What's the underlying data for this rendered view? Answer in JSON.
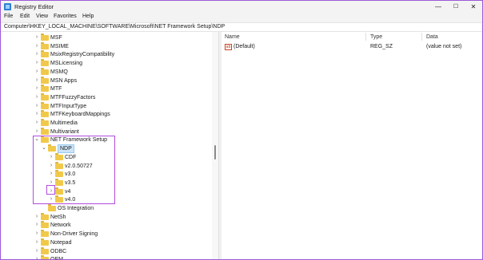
{
  "window": {
    "title": "Registry Editor",
    "minimize_glyph": "—",
    "maximize_glyph": "☐",
    "close_glyph": "✕"
  },
  "menu": [
    "File",
    "Edit",
    "View",
    "Favorites",
    "Help"
  ],
  "address": "Computer\\HKEY_LOCAL_MACHINE\\SOFTWARE\\Microsoft\\NET Framework Setup\\NDP",
  "tree": {
    "items": [
      {
        "label": "MSF",
        "expanded": false,
        "has_children": true
      },
      {
        "label": "MSIME",
        "expanded": false,
        "has_children": true
      },
      {
        "label": "MsixRegistryCompatibility",
        "expanded": false,
        "has_children": true
      },
      {
        "label": "MSLicensing",
        "expanded": false,
        "has_children": true
      },
      {
        "label": "MSMQ",
        "expanded": false,
        "has_children": true
      },
      {
        "label": "MSN Apps",
        "expanded": false,
        "has_children": true
      },
      {
        "label": "MTF",
        "expanded": false,
        "has_children": true
      },
      {
        "label": "MTFFuzzyFactors",
        "expanded": false,
        "has_children": true
      },
      {
        "label": "MTFInputType",
        "expanded": false,
        "has_children": true
      },
      {
        "label": "MTFKeyboardMappings",
        "expanded": false,
        "has_children": true
      },
      {
        "label": "Multimedia",
        "expanded": false,
        "has_children": true
      },
      {
        "label": "Multivariant",
        "expanded": false,
        "has_children": true
      },
      {
        "label": "NET Framework Setup",
        "expanded": true,
        "has_children": true
      },
      {
        "label": "NDP",
        "expanded": true,
        "has_children": true,
        "selected": true
      },
      {
        "label": "CDF",
        "expanded": false,
        "has_children": true
      },
      {
        "label": "v2.0.50727",
        "expanded": false,
        "has_children": true
      },
      {
        "label": "v3.0",
        "expanded": false,
        "has_children": true
      },
      {
        "label": "v3.5",
        "expanded": false,
        "has_children": true
      },
      {
        "label": "v4",
        "expanded": false,
        "has_children": true
      },
      {
        "label": "v4.0",
        "expanded": false,
        "has_children": true
      },
      {
        "label": "OS Integration",
        "expanded": false,
        "has_children": false
      },
      {
        "label": "NetSh",
        "expanded": false,
        "has_children": true
      },
      {
        "label": "Network",
        "expanded": false,
        "has_children": true
      },
      {
        "label": "Non-Driver Signing",
        "expanded": false,
        "has_children": true
      },
      {
        "label": "Notepad",
        "expanded": false,
        "has_children": true
      },
      {
        "label": "ODBC",
        "expanded": false,
        "has_children": true
      },
      {
        "label": "OEM",
        "expanded": false,
        "has_children": true
      }
    ]
  },
  "values": {
    "columns": [
      "Name",
      "Type",
      "Data"
    ],
    "rows": [
      {
        "icon": "string-value-icon",
        "icon_glyph": "ab",
        "name": "(Default)",
        "type": "REG_SZ",
        "data": "(value not set)"
      }
    ]
  },
  "colors": {
    "highlight": "#b04ce0",
    "selection": "#cce4f7",
    "folder": "#f1c94a"
  }
}
